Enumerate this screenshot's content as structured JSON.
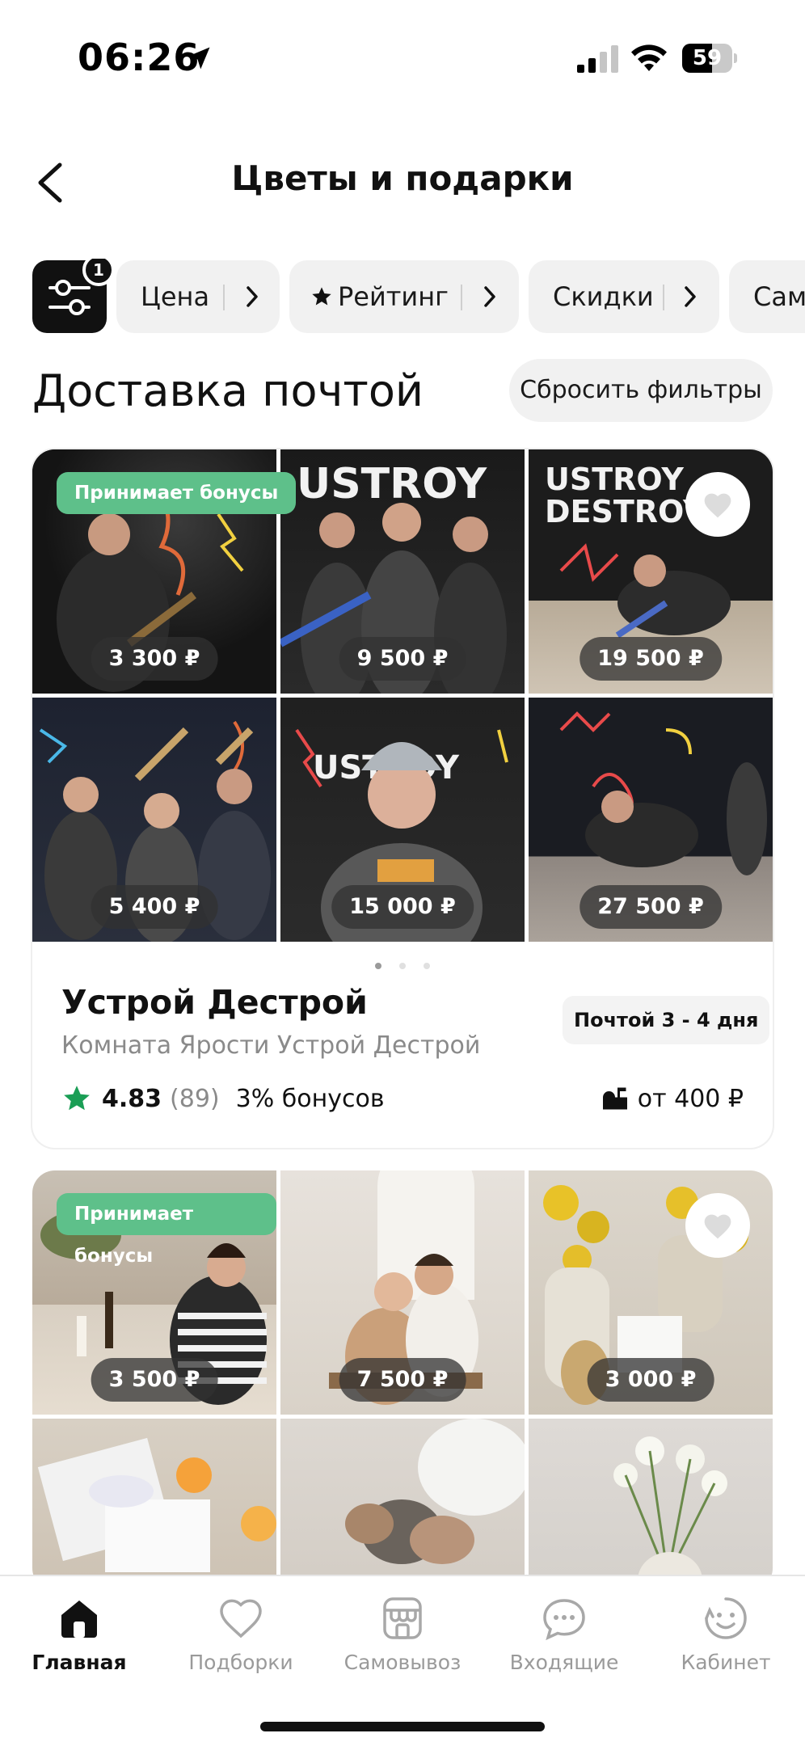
{
  "status_bar": {
    "time": "06:26",
    "battery": "59",
    "battery_level": 0.59
  },
  "header": {
    "title": "Цветы и подарки"
  },
  "filters": {
    "active_count": "1",
    "chips": [
      {
        "label": "Цена"
      },
      {
        "label": "Рейтинг",
        "icon": "star-icon"
      },
      {
        "label": "Скидки"
      },
      {
        "label": "Сам"
      }
    ]
  },
  "section": {
    "title": "Доставка почтой",
    "reset_label": "Сбросить фильтры"
  },
  "cards": [
    {
      "badge": "Принимает бонусы",
      "prices": [
        "3 300 ₽",
        "9 500 ₽",
        "19 500 ₽",
        "5 400 ₽",
        "15 000 ₽",
        "27 500 ₽"
      ],
      "name": "Устрой Дестрой",
      "subtitle": "Комната Ярости Устрой Дестрой",
      "delivery": "Почтой 3 - 4 дня",
      "rating": "4.83",
      "reviews": "(89)",
      "bonus": "3% бонусов",
      "shipping": "от 400 ₽",
      "colors": {
        "accent": "#5ec08a",
        "star": "#1a9e55"
      }
    },
    {
      "badge": "Принимает бонусы",
      "prices": [
        "3 500 ₽",
        "7 500 ₽",
        "3 000 ₽"
      ]
    }
  ],
  "bottom_nav": [
    {
      "label": "Главная",
      "icon": "home-icon",
      "active": true
    },
    {
      "label": "Подборки",
      "icon": "heart-icon"
    },
    {
      "label": "Самовывоз",
      "icon": "store-icon"
    },
    {
      "label": "Входящие",
      "icon": "chat-icon"
    },
    {
      "label": "Кабинет",
      "icon": "profile-icon"
    }
  ]
}
